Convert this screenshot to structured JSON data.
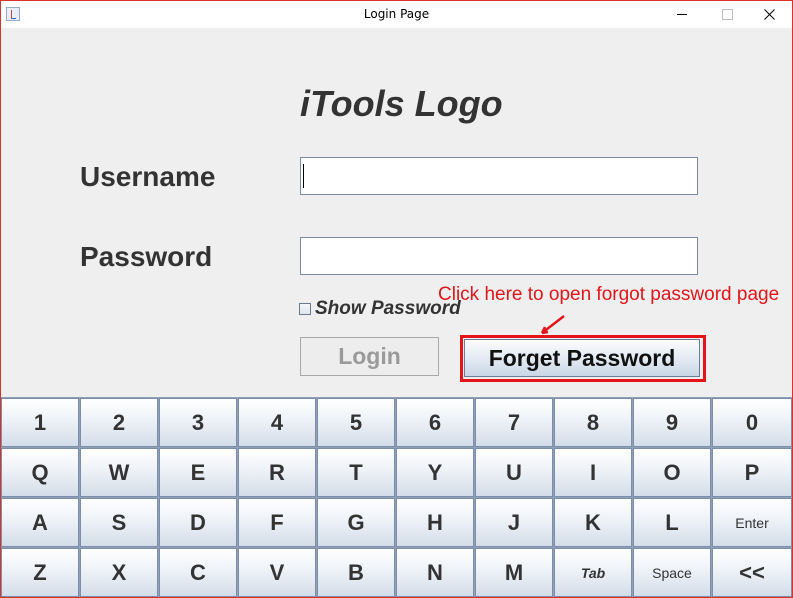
{
  "window": {
    "title": "Login Page"
  },
  "logo": {
    "text": "iTools Logo"
  },
  "form": {
    "username_label": "Username",
    "username_value": "",
    "password_label": "Password",
    "password_value": "",
    "show_password_label": "Show Password",
    "show_password_checked": false,
    "login_label": "Login",
    "forgot_label": "Forget Password"
  },
  "annotation": {
    "text": "Click here to open forgot password page",
    "color": "#e3151b"
  },
  "keyboard": {
    "rows": [
      [
        "1",
        "2",
        "3",
        "4",
        "5",
        "6",
        "7",
        "8",
        "9",
        "0"
      ],
      [
        "Q",
        "W",
        "E",
        "R",
        "T",
        "Y",
        "U",
        "I",
        "O",
        "P"
      ],
      [
        "A",
        "S",
        "D",
        "F",
        "G",
        "H",
        "J",
        "K",
        "L",
        "Enter"
      ],
      [
        "Z",
        "X",
        "C",
        "V",
        "B",
        "N",
        "M",
        "Tab",
        "Space",
        "<<"
      ]
    ]
  }
}
